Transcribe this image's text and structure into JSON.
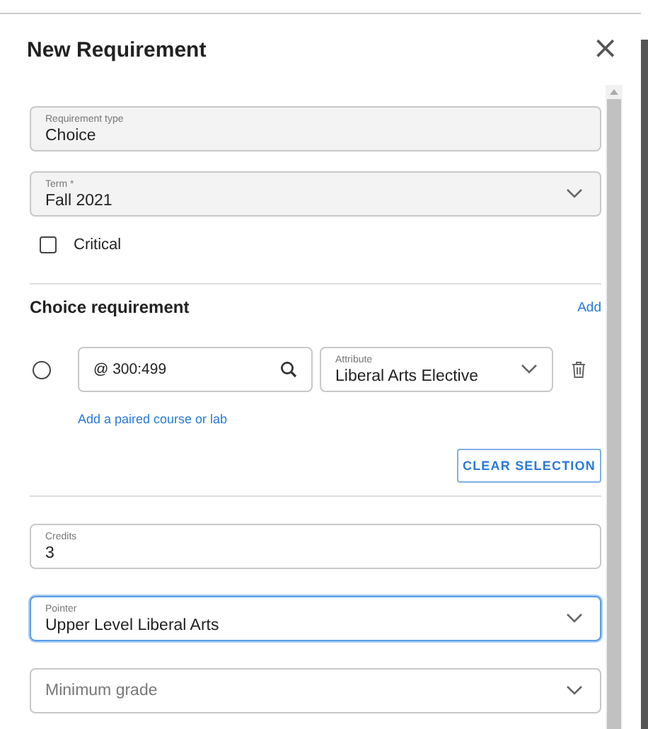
{
  "dialog": {
    "title": "New Requirement",
    "close": "×"
  },
  "fields_top": [
    {
      "kind": "text",
      "label": "Requirement type",
      "value": "Choice",
      "disabled": true
    },
    {
      "kind": "select",
      "label": "Term *",
      "value": "Fall 2021",
      "disabled": true
    }
  ],
  "critical": {
    "label": "Critical",
    "checked": false
  },
  "choice": {
    "heading": "Choice requirement",
    "add_link": "Add",
    "options": [
      {
        "selected": false,
        "course": "@ 300:499",
        "attribute_label": "Attribute",
        "attribute": "Liberal Arts Elective"
      }
    ],
    "paired_link": "Add a paired course or lab",
    "clear_button": "CLEAR SELECTION"
  },
  "fields_bottom": [
    {
      "kind": "text",
      "label": "Credits",
      "value": "3",
      "focused": false
    },
    {
      "kind": "select",
      "label": "Pointer",
      "value": "Upper Level Liberal Arts",
      "focused": true
    },
    {
      "kind": "select",
      "placeholder": "Minimum grade",
      "focused": false
    }
  ]
}
